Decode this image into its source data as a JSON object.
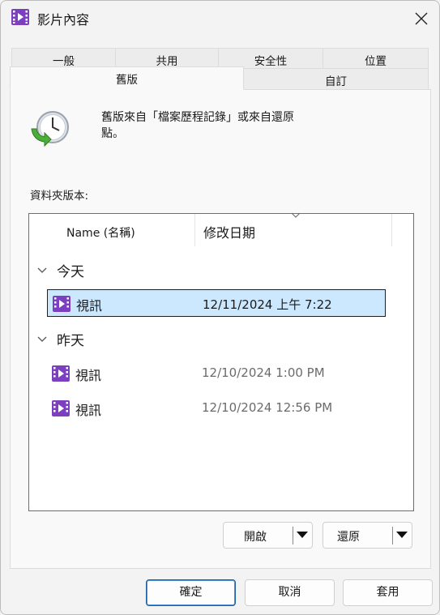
{
  "window": {
    "title": "影片內容"
  },
  "tabs": {
    "row1": [
      "一般",
      "共用",
      "安全性",
      "位置"
    ],
    "row2": [
      "舊版",
      "自訂"
    ],
    "active": "舊版"
  },
  "previous_versions": {
    "description": "舊版來自「檔案歷程記錄」或來自還原點。",
    "list_label": "資料夾版本:",
    "columns": {
      "name": "Name (名稱)",
      "date": "修改日期"
    },
    "groups": [
      {
        "label": "今天",
        "items": [
          {
            "name": "視訊",
            "date": "12/11/2024 上午 7:22",
            "selected": true
          }
        ]
      },
      {
        "label": "昨天",
        "items": [
          {
            "name": "視訊",
            "date": "12/10/2024 1:00 PM"
          },
          {
            "name": "視訊",
            "date": "12/10/2024 12:56 PM"
          }
        ]
      }
    ],
    "open_button": "開啟",
    "restore_button": "還原"
  },
  "footer": {
    "ok": "確定",
    "cancel": "取消",
    "apply": "套用"
  },
  "icons": {
    "app": "video-folder-icon",
    "history": "restore-clock-icon",
    "item": "video-folder-icon"
  },
  "colors": {
    "selection": "#cce8ff",
    "video_icon": "#8a47c8"
  }
}
